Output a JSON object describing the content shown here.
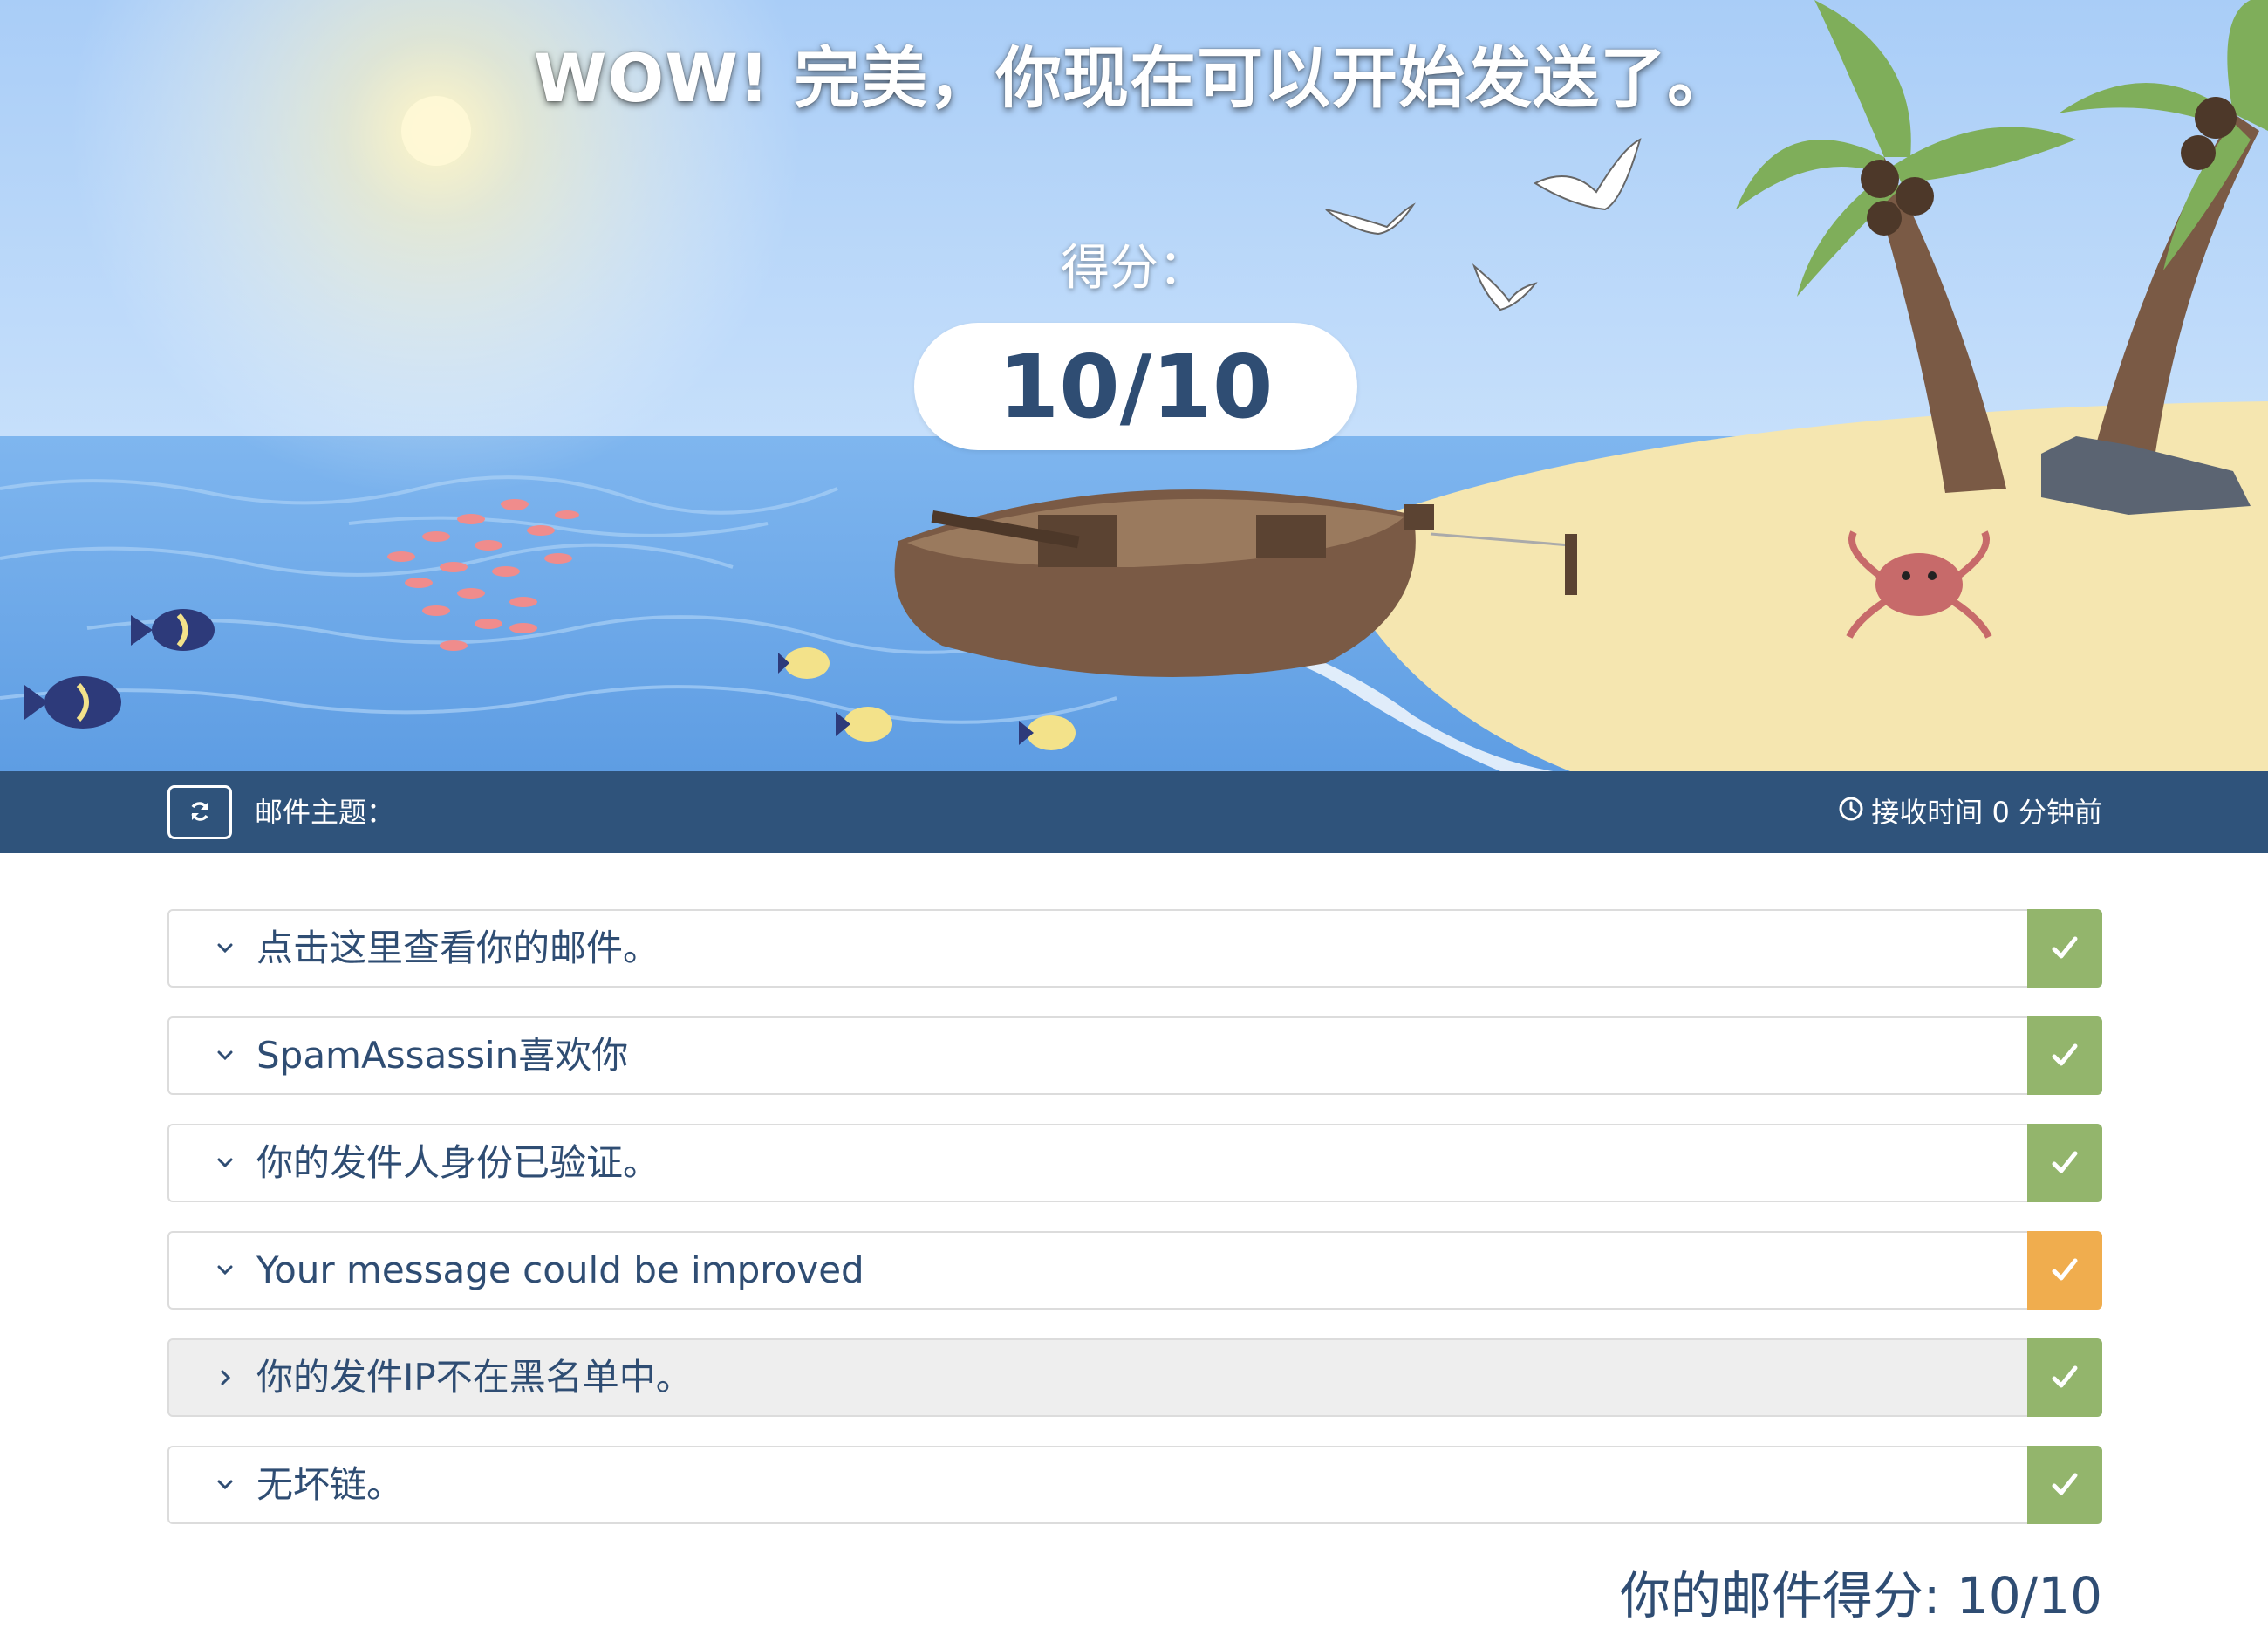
{
  "hero": {
    "title": "WOW! 完美，你现在可以开始发送了。",
    "score_label": "得分：",
    "score": "10/10"
  },
  "meta_bar": {
    "refresh_icon": "refresh-icon",
    "subject_label": "邮件主题：",
    "clock_icon": "clock-icon",
    "received_text": "接收时间 0 分钟前"
  },
  "colors": {
    "pass": "#93b56c",
    "warn": "#f0ad4e",
    "accent": "#2f537b",
    "text": "#2f4d73"
  },
  "checks": [
    {
      "label": "点击这里查看你的邮件。",
      "status": "pass",
      "expanded": true
    },
    {
      "label": "SpamAssassin喜欢你",
      "status": "pass",
      "expanded": true
    },
    {
      "label": "你的发件人身份已验证。",
      "status": "pass",
      "expanded": true
    },
    {
      "label": "Your message could be improved",
      "status": "warn",
      "expanded": true
    },
    {
      "label": "你的发件IP不在黑名单中。",
      "status": "pass",
      "expanded": false
    },
    {
      "label": "无坏链。",
      "status": "pass",
      "expanded": true
    }
  ],
  "footer": {
    "total_score": "你的邮件得分: 10/10"
  }
}
